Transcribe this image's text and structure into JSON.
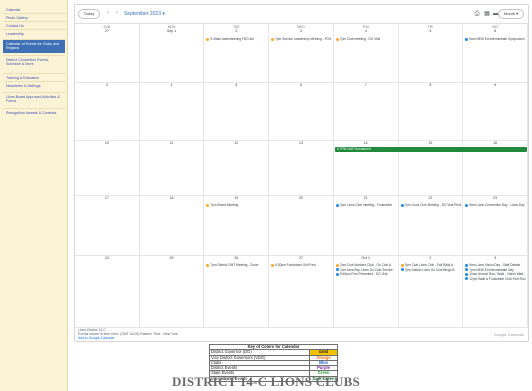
{
  "sidebar": {
    "items": [
      {
        "label": "Calendar"
      },
      {
        "label": "Photo Gallery"
      },
      {
        "label": "Contact Us"
      },
      {
        "label": "Leadership"
      },
      {
        "label": "Calendar of Events for Clubs and Regions",
        "active": true
      },
      {
        "label": "District Convention Events, Schedule & More"
      },
      {
        "label": "Training & Education"
      },
      {
        "label": "Newsletter & Mailings"
      },
      {
        "label": "Lions Board Approved Activities & Forms"
      },
      {
        "label": "Recognition Awards & Contests"
      }
    ]
  },
  "calendar": {
    "today_label": "Today",
    "prev_icon": "chevron-left-icon",
    "next_icon": "chevron-right-icon",
    "month_label": "September 2023 ▾",
    "view_label": "Month ▾",
    "weekdays": [
      "SUN",
      "MON",
      "TUE",
      "WED",
      "THU",
      "FRI",
      "SAT"
    ],
    "weeks": [
      {
        "days": [
          "27",
          "Sep 1",
          "2",
          "3",
          "4",
          "5",
          "6"
        ],
        "events": [
          [],
          [],
          [
            {
              "color": "#f9a825",
              "text": "9:30am Administering FDG Act"
            }
          ],
          [
            {
              "color": "#f9a825",
              "text": "7pm Service Leadership Meeting - FDG Act"
            }
          ],
          [
            {
              "color": "#f9a825",
              "text": "7pm Club meeting - DG Visit"
            }
          ],
          [],
          [
            {
              "color": "#1e88e5",
              "text": "9am NEW Ed Intermediate Symposium"
            }
          ]
        ]
      },
      {
        "days": [
          "3",
          "4",
          "5",
          "6",
          "7",
          "8",
          "9"
        ],
        "events": [
          [],
          [],
          [],
          [],
          [],
          [],
          []
        ]
      },
      {
        "days": [
          "10",
          "11",
          "12",
          "13",
          "14",
          "15",
          "16"
        ],
        "allday": "5-7PM Golf Tournament",
        "events": [
          [],
          [],
          [],
          [],
          [],
          [],
          []
        ]
      },
      {
        "days": [
          "17",
          "18",
          "19",
          "20",
          "21",
          "22",
          "23"
        ],
        "events": [
          [],
          [],
          [
            {
              "color": "#f9a825",
              "text": "7pm Board Meeting"
            }
          ],
          [],
          [
            {
              "color": "#1e88e5",
              "text": "7pm Lions Club meeting - Fundraiser"
            }
          ],
          [
            {
              "color": "#1e88e5",
              "text": "7pm Lions Club Meeting - DG Visit Pledge"
            }
          ],
          [
            {
              "color": "#1e88e5",
              "text": "9am Lions Convention Day - Lions Day"
            }
          ]
        ]
      },
      {
        "days": [
          "24",
          "25",
          "26",
          "27",
          "Oct 1",
          "2",
          "3"
        ],
        "events": [
          [],
          [],
          [
            {
              "color": "#f9a825",
              "text": "7pm District GMT Meeting - Zoom"
            }
          ],
          [
            {
              "color": "#f9a825",
              "text": "6:30pm Fundraiser Golf Fest"
            }
          ],
          [
            {
              "color": "#f9a825",
              "text": "7pm Club Workers Club - Go Club A"
            },
            {
              "color": "#1e88e5",
              "text": "7pm Area Rep Lions Go Club Service"
            },
            {
              "color": "#1e88e5",
              "text": "8:30pm Fest Presented - DG Visit"
            }
          ],
          [
            {
              "color": "#f9a825",
              "text": "7pm Club Lions Club - Fall Rally A"
            },
            {
              "color": "#1e88e5",
              "text": "7pm District Lions Go Club Bingo B"
            }
          ],
          [
            {
              "color": "#1e88e5",
              "text": "9am Lions Vision Day - Staff Details"
            },
            {
              "color": "#1e88e5",
              "text": "7pm NEW Ed Intermediate Day"
            },
            {
              "color": "#1e88e5",
              "text": "10am Annual Run / Walk - Vision Walk"
            },
            {
              "color": "#1e88e5",
              "text": "12pm Walk & Fundraiser Club Fest Run"
            }
          ]
        ]
      }
    ],
    "timezone_line1": "Lions District 14-C",
    "timezone_line2": "Events shown in time zone: (GMT-04:00) Eastern Time - New York",
    "timezone_line3": "Add to Google Calendar",
    "branding": "Google Calendar"
  },
  "key": {
    "title": "Key of Colors for Calendar",
    "rows": [
      {
        "label": "District Governor (DG)",
        "swatch": "Gold",
        "color": "#f2c200",
        "text_color": "#222222"
      },
      {
        "label": "Vice District Governors (VDG)",
        "swatch": "Orange",
        "color": "#ffffff",
        "text_color": "#ef6c00"
      },
      {
        "label": "Clubs",
        "swatch": "Blue",
        "color": "#ffffff",
        "text_color": "#1e5fd0"
      },
      {
        "label": "District Events",
        "swatch": "Purple",
        "color": "#ffffff",
        "text_color": "#7b1fa2"
      },
      {
        "label": "State Events",
        "swatch": "Green",
        "color": "#ffffff",
        "text_color": "#2e9a3a"
      },
      {
        "label": "International Events",
        "swatch": "Dark Green",
        "color": "#ffffff",
        "text_color": "#1b6e2e"
      }
    ]
  },
  "footer": {
    "title": "DISTRICT 14-C LIONS CLUBS"
  }
}
